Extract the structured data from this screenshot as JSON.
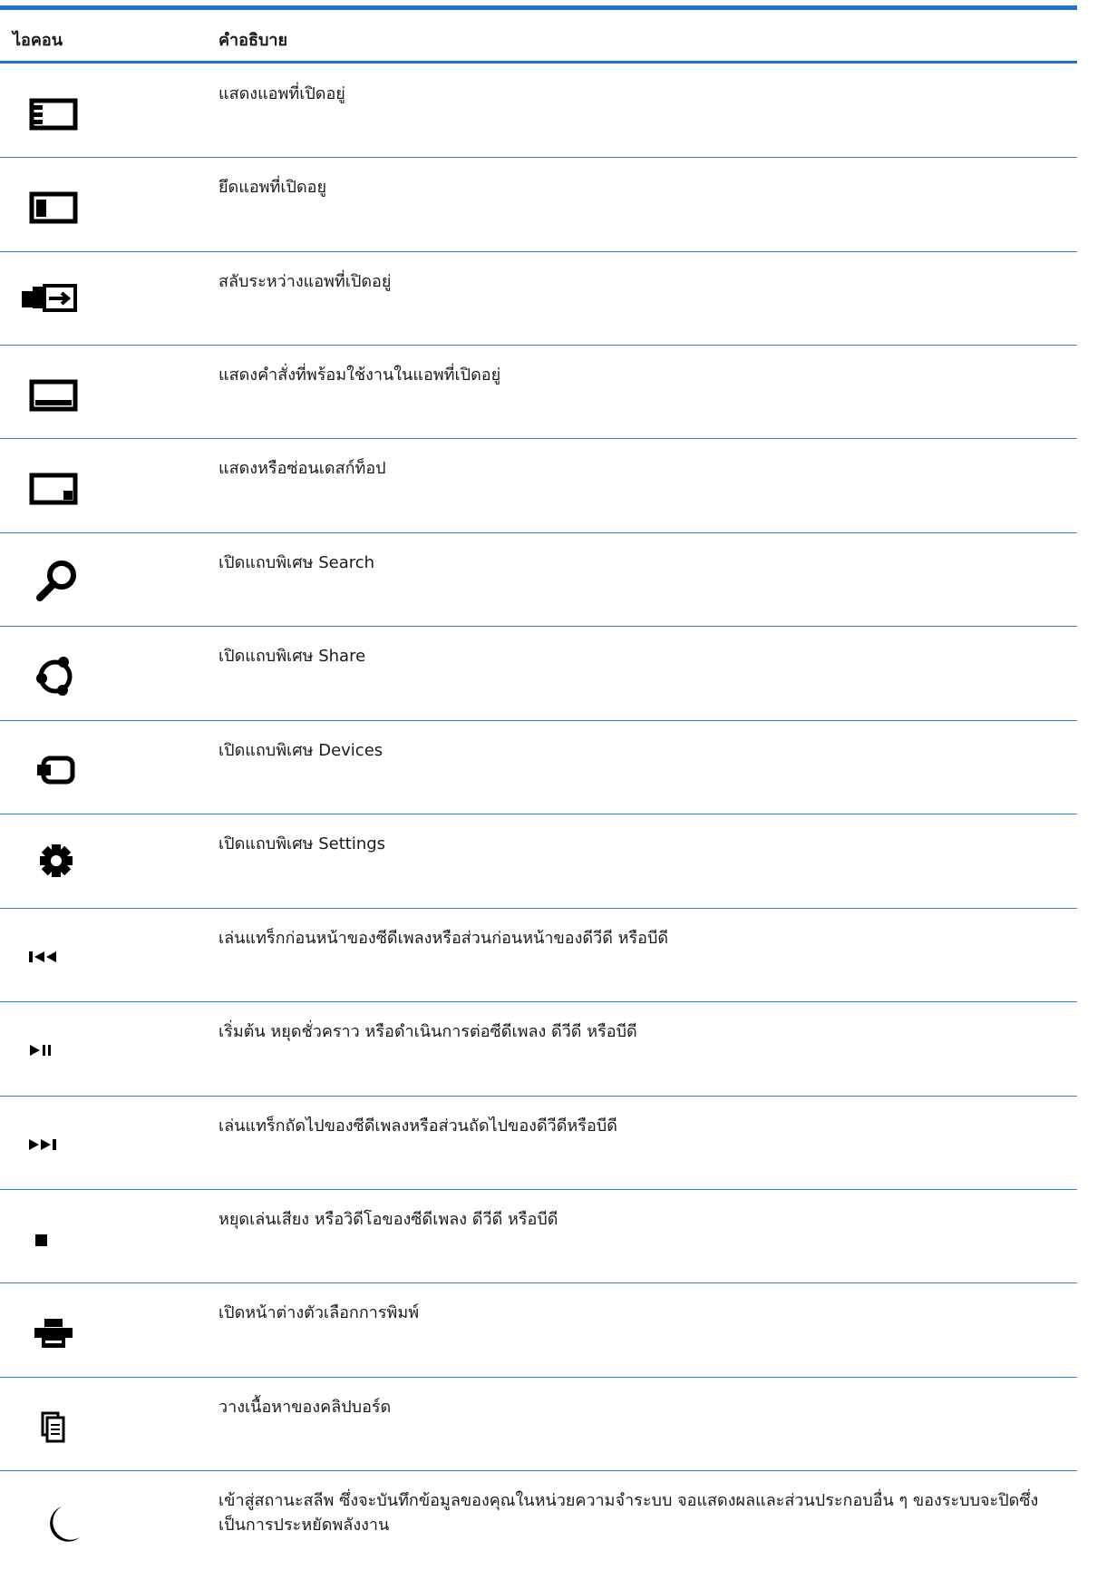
{
  "header": {
    "icon_col": "ไอคอน",
    "desc_col": "คำอธิบาย"
  },
  "rows": [
    {
      "icon": "list-window-icon",
      "desc": "แสดงแอพที่เปิดอยู่"
    },
    {
      "icon": "snap-window-icon",
      "desc": "ยึดแอพที่เปิดอยู"
    },
    {
      "icon": "switch-apps-icon",
      "desc": "สลับระหว่างแอพที่เปิดอยู่"
    },
    {
      "icon": "app-commands-icon",
      "desc": "แสดงคำสั่งที่พร้อมใช้งานในแอพที่เปิดอยู่"
    },
    {
      "icon": "show-desktop-icon",
      "desc": "แสดงหรือซ่อนเดสก์ท็อป"
    },
    {
      "icon": "search-icon",
      "desc": "เปิดแถบพิเศษ Search"
    },
    {
      "icon": "share-icon",
      "desc": "เปิดแถบพิเศษ Share"
    },
    {
      "icon": "devices-icon",
      "desc": "เปิดแถบพิเศษ Devices"
    },
    {
      "icon": "settings-gear-icon",
      "desc": "เปิดแถบพิเศษ Settings"
    },
    {
      "icon": "previous-track-icon",
      "desc": "เล่นแทร็กก่อนหน้าของซีดีเพลงหรือส่วนก่อนหน้าของดีวีดี หรือบีดี"
    },
    {
      "icon": "play-pause-icon",
      "desc": "เริ่มต้น หยุดชั่วคราว หรือดำเนินการต่อซีดีเพลง ดีวีดี หรือบีดี"
    },
    {
      "icon": "next-track-icon",
      "desc": "เล่นแทร็กถัดไปของซีดีเพลงหรือส่วนถัดไปของดีวีดีหรือบีดี"
    },
    {
      "icon": "stop-icon",
      "desc": "หยุดเล่นเสียง หรือวิดีโอของซีดีเพลง ดีวีดี หรือบีดี"
    },
    {
      "icon": "print-icon",
      "desc": "เปิดหน้าต่างตัวเลือกการพิมพ์"
    },
    {
      "icon": "paste-clipboard-icon",
      "desc": "วางเนื้อหาของคลิปบอร์ด"
    },
    {
      "icon": "sleep-moon-icon",
      "desc": "เข้าสู่สถานะสลีพ ซึ่งจะบันทึกข้อมูลของคุณในหน่วยความจำระบบ จอแสดงผลและส่วนประกอบอื่น ๆ ของระบบจะปิดซึ่งเป็นการประหยัดพลังงาน"
    }
  ]
}
